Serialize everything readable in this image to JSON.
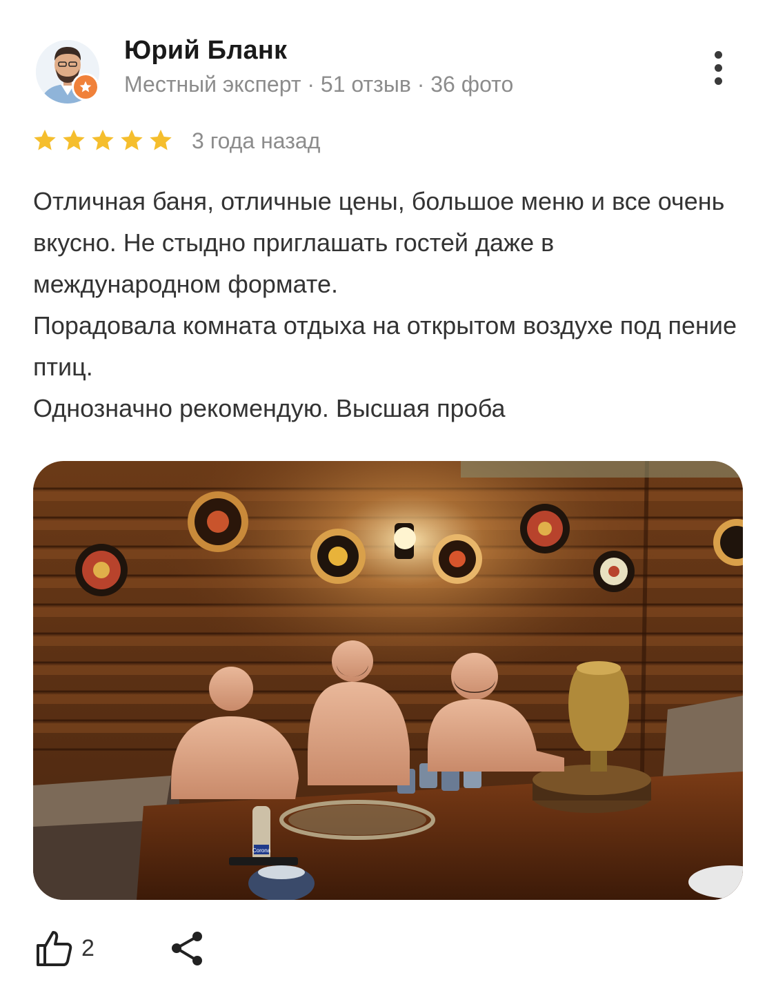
{
  "author": {
    "name": "Юрий Бланк",
    "meta": "Местный эксперт · 51 отзыв · 36 фото",
    "avatar_icon": "person-avatar",
    "badge_icon": "star-badge-icon",
    "badge_color": "#f0813a"
  },
  "menu": {
    "icon": "more-vertical-icon"
  },
  "rating": {
    "stars": 5,
    "max": 5,
    "star_color": "#f5be2d",
    "date": "3 года назад"
  },
  "review": {
    "paragraphs": [
      "Отличная баня, отличные цены, большое меню и все очень вкусно. Не стыдно приглашать гостей даже в международном формате.",
      "Порадовала комната отдыха на открытом воздухе под пение птиц.",
      "Однозначно рекомендую. Высшая проба"
    ]
  },
  "photo": {
    "icon": "review-photo",
    "bottle_label": "Corona"
  },
  "actions": {
    "like_icon": "thumbs-up-icon",
    "like_count": "2",
    "share_icon": "share-icon"
  }
}
